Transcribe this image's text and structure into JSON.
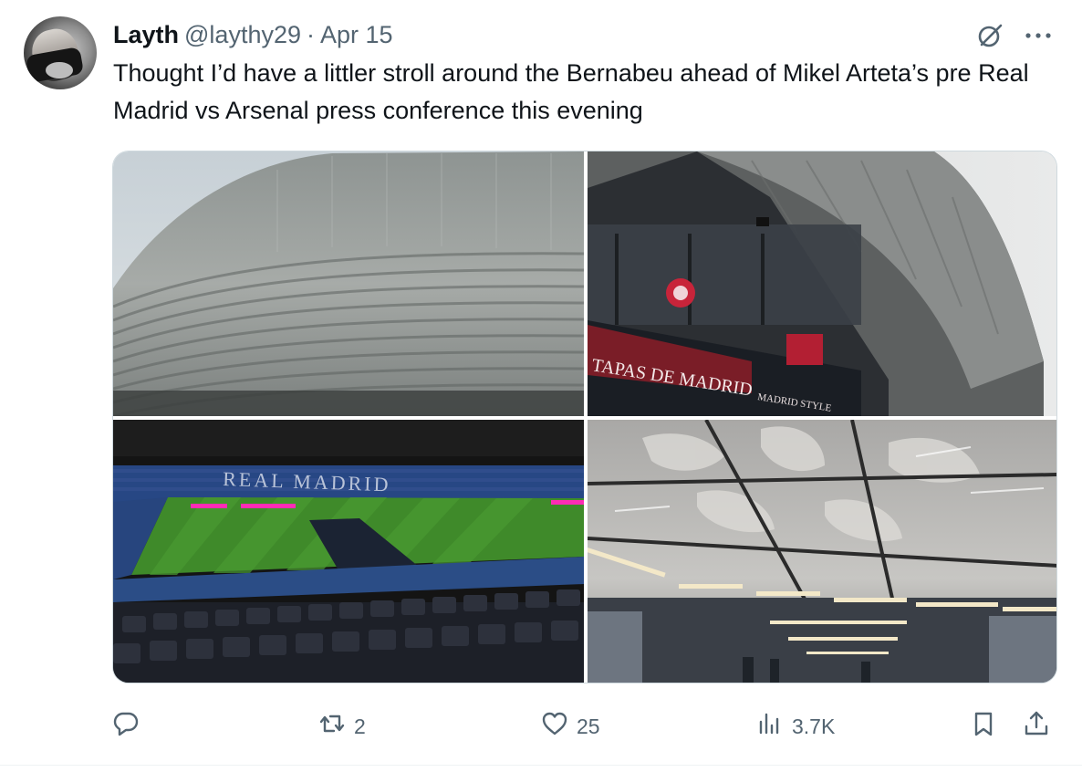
{
  "tweet": {
    "author_name": "Layth",
    "author_handle": "@laythy29",
    "separator": "·",
    "date": "Apr 15",
    "text": "Thought I’d have a littler stroll around the Bernabeu ahead of Mikel Arteta’s pre Real Madrid vs Arsenal press conference this evening",
    "avatar_icon": "avatar-photo",
    "header_icons": [
      "grok-icon",
      "more-icon"
    ]
  },
  "media": {
    "photos": [
      {
        "icon": "stadium-exterior-photo"
      },
      {
        "icon": "stadium-facade-photo",
        "signs": [
          "TAPAS DE MADRID",
          "MADRID STYLE"
        ]
      },
      {
        "icon": "stadium-interior-photo",
        "stand_text": "REAL MADRID"
      },
      {
        "icon": "ceiling-photo"
      }
    ]
  },
  "actions": {
    "reply_count": "",
    "repost_count": "2",
    "like_count": "25",
    "views_count": "3.7K",
    "icons": [
      "reply-icon",
      "repost-icon",
      "like-icon",
      "views-icon",
      "bookmark-icon",
      "share-icon"
    ]
  },
  "colors": {
    "text_primary": "#0f1419",
    "text_secondary": "#536471",
    "border": "#cfd9de"
  }
}
